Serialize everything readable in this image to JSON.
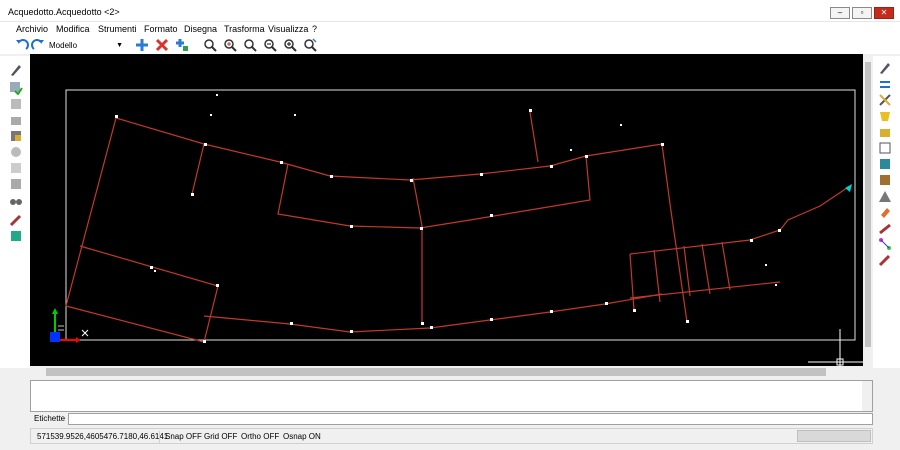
{
  "window": {
    "title": "Acquedotto.Acquedotto <2>"
  },
  "menu": [
    "Archivio",
    "Modifica",
    "Strumenti",
    "Formato",
    "Disegna",
    "Trasforma",
    "Visualizza",
    "?"
  ],
  "toolbar": {
    "space_selector": "Modello"
  },
  "icons": {
    "undo": "undo-icon",
    "redo": "redo-icon",
    "move": "move-icon",
    "delete": "delete-icon",
    "copy": "copy-icon",
    "zoom": [
      "zoom-window-icon",
      "zoom-extents-icon",
      "zoom-realtime-icon",
      "zoom-out-icon",
      "zoom-in-icon",
      "zoom-previous-icon"
    ]
  },
  "command_line": {
    "labels_tab": "Etichette"
  },
  "status": {
    "coordinates": "571539.9526,4605476.7180,46.6141",
    "snap": "Snap OFF",
    "grid": "Grid OFF",
    "ortho": "Ortho OFF",
    "osnap": "Osnap ON"
  },
  "colors": {
    "pipes": "#c0392b",
    "canvas_bg": "#000000",
    "ucs_x": "#ff0000",
    "ucs_y": "#00cc00",
    "ucs_origin": "#0000ff"
  }
}
